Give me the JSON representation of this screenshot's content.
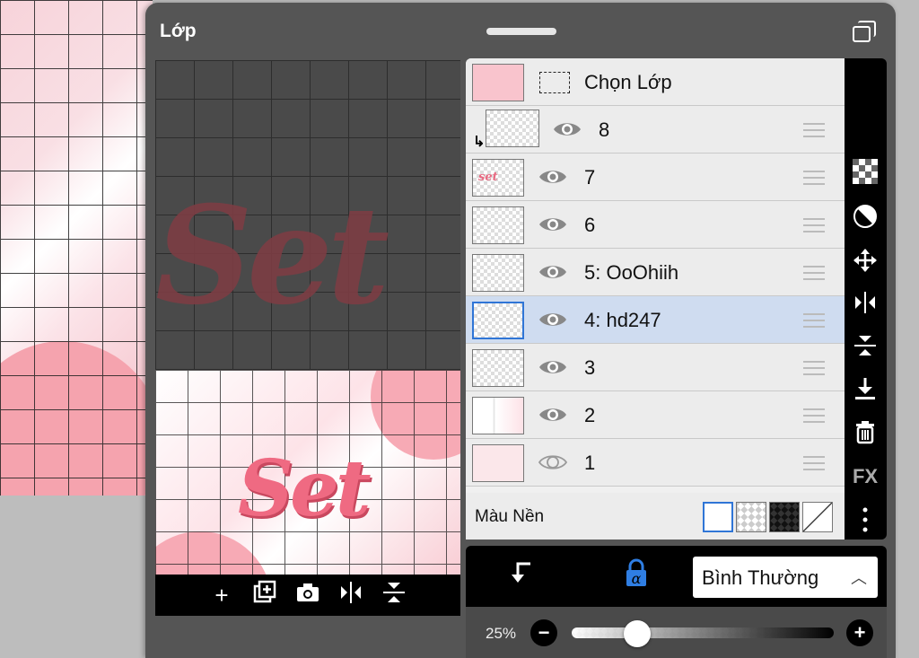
{
  "panel": {
    "title": "Lớp"
  },
  "layers_panel": {
    "select_layer_label": "Chọn Lớp",
    "layers": [
      {
        "name": "8",
        "visible": true,
        "selected": false,
        "clipping": true
      },
      {
        "name": "7",
        "visible": true,
        "selected": false,
        "clipping": false,
        "thumb_text": "set"
      },
      {
        "name": "6",
        "visible": true,
        "selected": false,
        "clipping": false
      },
      {
        "name": "5: OoOhiih",
        "visible": true,
        "selected": false,
        "clipping": false
      },
      {
        "name": "4: hd247",
        "visible": true,
        "selected": true,
        "clipping": false
      },
      {
        "name": "3",
        "visible": true,
        "selected": false,
        "clipping": false
      },
      {
        "name": "2",
        "visible": true,
        "selected": false,
        "clipping": false
      },
      {
        "name": "1",
        "visible": false,
        "selected": false,
        "clipping": false
      }
    ],
    "background_label": "Màu Nền"
  },
  "canvas_art": {
    "word": "Set"
  },
  "side_toolbar": {
    "icons": [
      "checkerboard-icon",
      "adjust-icon",
      "move-icon",
      "flip-horizontal-icon",
      "flip-vertical-icon",
      "merge-down-icon",
      "trash-icon",
      "fx-icon",
      "more-icon"
    ],
    "fx_label": "FX"
  },
  "preview_toolbar": {
    "icons": [
      "add-layer-icon",
      "duplicate-layer-icon",
      "camera-icon",
      "flip-horizontal-icon",
      "flip-vertical-icon"
    ]
  },
  "blend": {
    "mode": "Bình Thường",
    "alpha_lock_glyph": "α",
    "opacity_label": "25%",
    "opacity": 0.25
  },
  "colors": {
    "selected_row": "#cfdcf0",
    "accent_blue": "#2f75d6",
    "pink": "#ef6a82"
  }
}
